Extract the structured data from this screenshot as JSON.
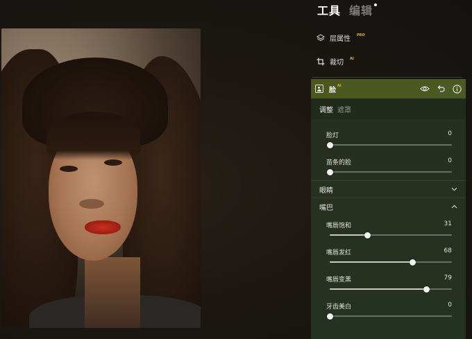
{
  "header": {
    "tab_tools": "工具",
    "tab_edit": "编辑"
  },
  "tools": {
    "layers_label": "层属性",
    "layers_tag": "PRO",
    "crop_label": "裁切",
    "crop_tag": "AI"
  },
  "face_panel": {
    "title": "脸",
    "title_tag": "AI",
    "subtabs": [
      "调整",
      "遮罩"
    ],
    "active_subtab": "调整",
    "sliders": [
      {
        "label": "脸灯",
        "value": "0",
        "level": 0.0
      },
      {
        "label": "苗条的脸",
        "value": "0",
        "level": 0.0
      }
    ],
    "eyes_section": "眼睛",
    "mouth_section": "嘴巴",
    "mouth_sliders": [
      {
        "label": "嘴唇饱和",
        "value": "31",
        "level": 0.31
      },
      {
        "label": "嘴唇发红",
        "value": "68",
        "level": 0.68
      },
      {
        "label": "嘴唇变黑",
        "value": "79",
        "level": 0.79
      },
      {
        "label": "牙齿美白",
        "value": "0",
        "level": 0.0
      }
    ]
  },
  "colors": {
    "panel_header": "#4b571f",
    "accent_tag": "#d6b23a",
    "lips": "#c8311f"
  },
  "icons": [
    "layers-icon",
    "crop-icon",
    "face-icon",
    "eye-icon",
    "undo-icon",
    "info-icon",
    "chevron-down-icon",
    "chevron-up-icon"
  ]
}
